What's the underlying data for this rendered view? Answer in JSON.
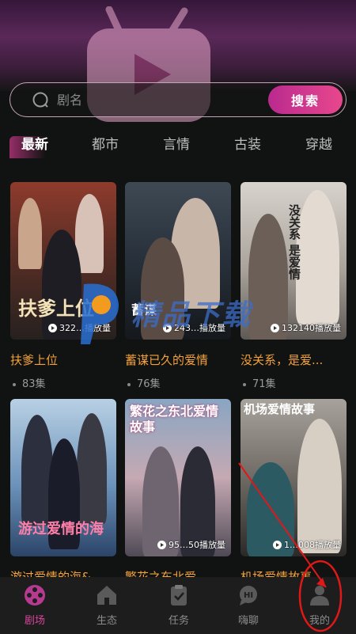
{
  "search": {
    "placeholder": "剧名",
    "button_label": "搜索"
  },
  "tabs": [
    {
      "label": "最新",
      "active": true
    },
    {
      "label": "都市",
      "active": false
    },
    {
      "label": "言情",
      "active": false
    },
    {
      "label": "古装",
      "active": false
    },
    {
      "label": "穿越",
      "active": false
    }
  ],
  "cards": [
    {
      "title": "扶爹上位",
      "episodes": "83集",
      "plays": "322…播放量",
      "poster_text": "扶爹上位",
      "colors": [
        "#a63a2a",
        "#3c2a20"
      ]
    },
    {
      "title": "蓄谋已久的爱情",
      "episodes": "76集",
      "plays": "243…播放量",
      "poster_text": "蓄谋",
      "colors": [
        "#3e4a55",
        "#171b20"
      ]
    },
    {
      "title": "没关系，是爱...",
      "episodes": "71集",
      "plays": "132140播放量",
      "poster_text": "没关系 是爱情",
      "colors": [
        "#c9c4bd",
        "#6b6560"
      ]
    },
    {
      "title": "游过爱情的海&...",
      "episodes": "",
      "plays": "",
      "poster_text": "游过爱情的海",
      "colors": [
        "#7aa4c9",
        "#2a3f63"
      ]
    },
    {
      "title": "繁花之东北爱...",
      "episodes": "",
      "plays": "95…50播放量",
      "poster_text": "繁花之东北爱情故事",
      "colors": [
        "#6d8aa8",
        "#c9a5a8"
      ]
    },
    {
      "title": "机场爱情故事...",
      "episodes": "",
      "plays": "1…008播放量",
      "poster_text": "机场爱情故事",
      "colors": [
        "#8f8a84",
        "#2e2c2a"
      ]
    }
  ],
  "watermark": {
    "text": "精品下载"
  },
  "nav": [
    {
      "label": "剧场",
      "icon": "film-reel-icon",
      "active": true
    },
    {
      "label": "生态",
      "icon": "home-icon",
      "active": false
    },
    {
      "label": "任务",
      "icon": "clipboard-check-icon",
      "active": false
    },
    {
      "label": "嗨聊",
      "icon": "chat-bubble-icon",
      "active": false
    },
    {
      "label": "我的",
      "icon": "user-icon",
      "active": false
    }
  ],
  "colors": {
    "accent": "#d9459b",
    "title_orange": "#f3a13c",
    "annotation_red": "#e01818"
  }
}
